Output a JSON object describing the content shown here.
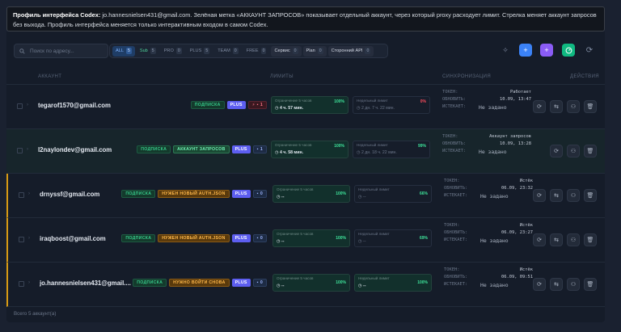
{
  "tooltip": {
    "bold": "Профиль интерфейса Codex:",
    "text": " jo.hannesnielsen431@gmail.com. Зелёная метка «АККАУНТ ЗАПРОСОВ» показывает отдельный аккаунт, через который proxy расходует лимит. Стрелка меняет аккаунт запросов без выхода. Профиль интерфейса меняется только интерактивным входом в самом Codex."
  },
  "search": {
    "placeholder": "Поиск по адресу..."
  },
  "filters": [
    {
      "label": "ALL",
      "count": "5"
    },
    {
      "label": "Sub",
      "count": "5"
    },
    {
      "label": "PRO",
      "count": "0"
    },
    {
      "label": "PLUS",
      "count": "5"
    },
    {
      "label": "TEAM",
      "count": "0"
    },
    {
      "label": "FREE",
      "count": "0"
    },
    {
      "label": "Сервис",
      "count": "0"
    },
    {
      "label": "Plan",
      "count": "0"
    },
    {
      "label": "Сторонний API",
      "count": "0"
    }
  ],
  "colors": {
    "blue": "#3b82f6",
    "purple": "#8b5cf6",
    "green": "#10b981"
  },
  "headers": {
    "account": "АККАУНТ",
    "limits": "ЛИМИТЫ",
    "sync": "СИНХРОНИЗАЦИЯ",
    "actions": "ДЕЙСТВИЯ"
  },
  "labels": {
    "sub": "ПОДПИСКА",
    "plus": "PLUS",
    "req": "АККАУНТ ЗАПРОСОВ",
    "auth": "НУЖЕН НОВЫЙ AUTH.JSON",
    "relogin": "НУЖНО ВОЙТИ СНОВА",
    "lim5": "Ограничение 5 часов",
    "limw": "Недельный лимит",
    "token": "ТОКЕН:",
    "update": "ОБНОВИТЬ:",
    "expires": "ИСТЕКАЕТ:"
  },
  "rows": [
    {
      "email": "tegarof1570@gmail.com",
      "badge2": "",
      "count": "1",
      "lim5_pct": "100%",
      "lim5_reset": "4 ч. 57 мин.",
      "limw_pct": "0%",
      "limw_reset": "2 дн. 7 ч. 22 мин.",
      "token": "Работает",
      "update": "10.09, 13:47",
      "expires": "Не задано"
    },
    {
      "email": "l2naylondev@gmail.com",
      "badge2": "АККАУНТ ЗАПРОСОВ",
      "count": "1",
      "lim5_pct": "100%",
      "lim5_reset": "4 ч. 58 мин.",
      "limw_pct": "99%",
      "limw_reset": "2 дн. 18 ч. 22 мин.",
      "token": "Аккаунт запросов",
      "update": "10.09, 13:28",
      "expires": "Не задано"
    },
    {
      "email": "drnyssf@gmail.com",
      "badge2": "НУЖЕН НОВЫЙ AUTH.JSON",
      "count": "0",
      "lim5_pct": "100%",
      "lim5_reset": "--",
      "limw_pct": "66%",
      "limw_reset": "--",
      "token": "Истёк",
      "update": "06.09, 23:32",
      "expires": "Не задано"
    },
    {
      "email": "iraqboost@gmail.com",
      "badge2": "НУЖЕН НОВЫЙ AUTH.JSON",
      "count": "0",
      "lim5_pct": "100%",
      "lim5_reset": "--",
      "limw_pct": "69%",
      "limw_reset": "--",
      "token": "Истёк",
      "update": "06.09, 23:27",
      "expires": "Не задано"
    },
    {
      "email": "jo.hannesnielsen431@gmail....",
      "badge2": "НУЖНО ВОЙТИ СНОВА",
      "count": "0",
      "lim5_pct": "100%",
      "lim5_reset": "--",
      "limw_pct": "100%",
      "limw_reset": "--",
      "token": "Истёк",
      "update": "06.09, 09:51",
      "expires": "Не задано"
    }
  ],
  "footer": "Всего 5 аккаунт(а)"
}
